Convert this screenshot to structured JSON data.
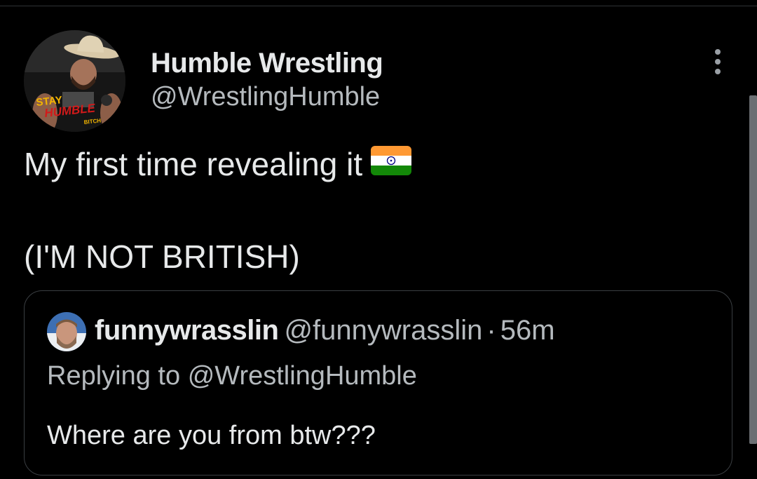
{
  "author": {
    "name": "Humble Wrestling",
    "handle": "@WrestlingHumble",
    "avatar_text_top": "STAY",
    "avatar_text_mid": "HUMBLE",
    "avatar_text_small": "BITCH"
  },
  "tweet": {
    "line1": "My first time revealing it",
    "flag_emoji_name": "india-flag-icon",
    "line2": "(I'M NOT BRITISH)"
  },
  "quoted": {
    "name": "funnywrasslin",
    "handle": "@funnywrasslin",
    "separator": "·",
    "time": "56m",
    "replying_prefix": "Replying to",
    "replying_handle": "@WrestlingHumble",
    "text": "Where are you from btw???"
  },
  "colors": {
    "background": "#000000",
    "primary_text": "#e7e9ea",
    "secondary_text": "#b5babe",
    "border": "#3a3e42",
    "flag_saffron": "#ff9933",
    "flag_white": "#ffffff",
    "flag_green": "#138808",
    "chakra_blue": "#000080"
  }
}
